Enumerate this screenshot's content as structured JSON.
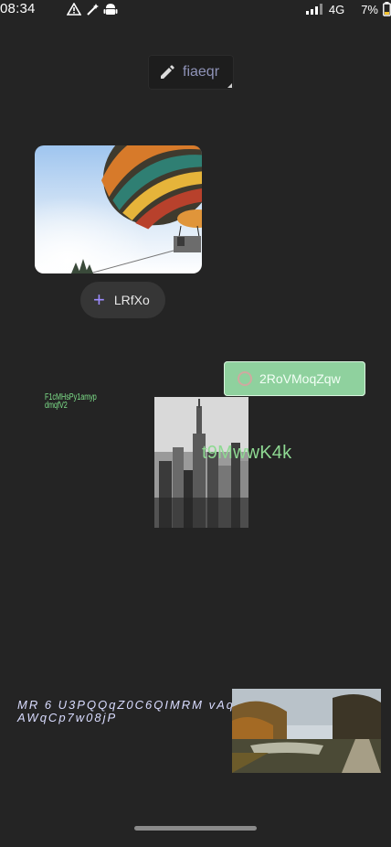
{
  "status_bar": {
    "time": "08:34",
    "network": "4G",
    "battery": "7%",
    "icons_left": [
      "warning-icon",
      "magic-wand-icon",
      "android-icon"
    ],
    "icons_right": [
      "signal-icon",
      "battery-icon"
    ]
  },
  "edit_chip": {
    "icon": "pencil-icon",
    "label": "fiaeqr"
  },
  "images": {
    "balloon": "hot-air-balloon-photo",
    "city": "city-skyline-photo",
    "lake": "autumn-lake-road-photo"
  },
  "add_chip": {
    "icon": "plus-icon",
    "label": "LRfXo"
  },
  "green_button": {
    "icon": "ring-icon",
    "label": "2RoVMoqZqw"
  },
  "tiny_text": "F1cMHsPy1amypdmqfV2",
  "overlay_text": "t9MwwK4k",
  "italic_text": "MR 6 U3PQQqZ0C6QIMRM vAq Z bZ4 fknAWqCp7w08jP",
  "colors": {
    "background": "#242424",
    "accent_green": "#8fd19e",
    "accent_purple": "#9d8cff",
    "chip_text": "#8f93b8"
  }
}
